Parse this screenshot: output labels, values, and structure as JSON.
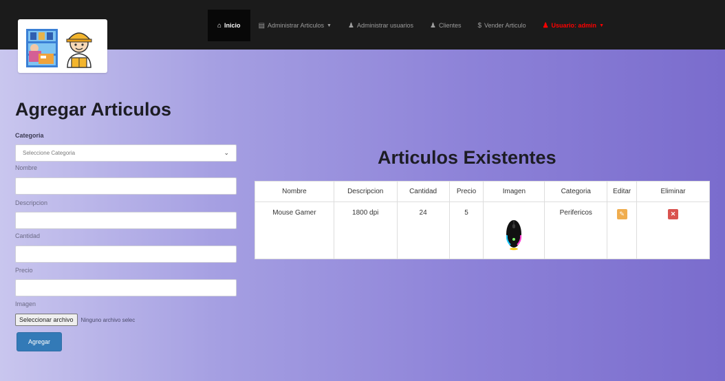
{
  "navbar": {
    "logo_alt": "logo",
    "items": [
      {
        "label": "Inicio",
        "icon": "home-icon"
      },
      {
        "label": "Administrar Articulos",
        "icon": "list-icon"
      },
      {
        "label": "Administrar usuarios",
        "icon": "user-icon"
      },
      {
        "label": "Clientes",
        "icon": "user-icon"
      },
      {
        "label": "Vender Articulo",
        "icon": "dollar-icon"
      },
      {
        "label": "Usuario: admin",
        "icon": "user-icon"
      }
    ]
  },
  "form": {
    "title": "Agregar Articulos",
    "categoria_label": "Categoria",
    "categoria_selected": "Seleccione Categoria",
    "nombre_label": "Nombre",
    "descripcion_label": "Descripcion",
    "cantidad_label": "Cantidad",
    "precio_label": "Precio",
    "imagen_label": "Imagen",
    "file_button": "Seleccionar archivo",
    "file_status": "Ninguno archivo selec",
    "submit_label": "Agregar"
  },
  "articles": {
    "title": "Articulos Existentes",
    "headers": [
      "Nombre",
      "Descripcion",
      "Cantidad",
      "Precio",
      "Imagen",
      "Categoria",
      "Editar",
      "Eliminar"
    ],
    "rows": [
      {
        "nombre": "Mouse Gamer",
        "descripcion": "1800 dpi",
        "cantidad": "24",
        "precio": "5",
        "imagen": "mouse-image",
        "categoria": "Perifericos"
      }
    ]
  },
  "colors": {
    "navbar": "#1b1b1b",
    "primary_button": "#337ab7",
    "edit_button": "#f0ad4e",
    "delete_button": "#d9534f",
    "user_link": "#ff0000"
  }
}
